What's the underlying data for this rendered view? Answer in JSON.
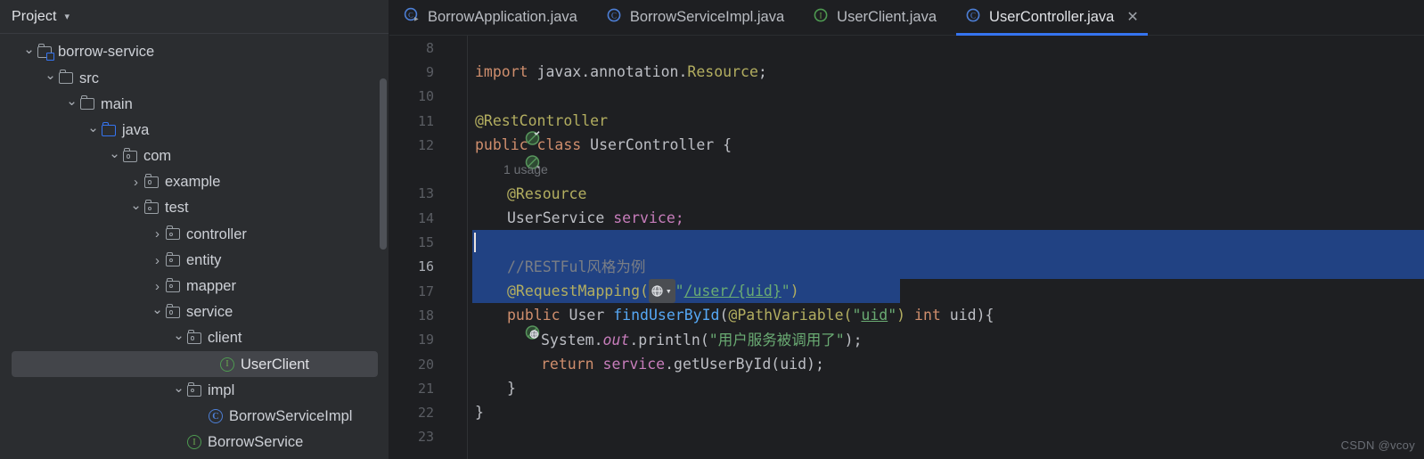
{
  "sidebar": {
    "header": {
      "title": "Project",
      "chevron_icon": "chevron-down-icon"
    },
    "tree": [
      {
        "label": "borrow-service",
        "icon": "module-folder-icon",
        "twisty": "expanded",
        "depth": 1
      },
      {
        "label": "src",
        "icon": "folder-icon",
        "twisty": "expanded",
        "depth": 2
      },
      {
        "label": "main",
        "icon": "folder-icon",
        "twisty": "expanded",
        "depth": 3
      },
      {
        "label": "java",
        "icon": "source-folder-icon",
        "twisty": "expanded",
        "depth": 4
      },
      {
        "label": "com",
        "icon": "package-icon",
        "twisty": "expanded",
        "depth": 5
      },
      {
        "label": "example",
        "icon": "package-icon",
        "twisty": "collapsed",
        "depth": 6
      },
      {
        "label": "test",
        "icon": "package-icon",
        "twisty": "expanded",
        "depth": 6
      },
      {
        "label": "controller",
        "icon": "package-icon",
        "twisty": "collapsed",
        "depth": 7
      },
      {
        "label": "entity",
        "icon": "package-icon",
        "twisty": "collapsed",
        "depth": 7
      },
      {
        "label": "mapper",
        "icon": "package-icon",
        "twisty": "collapsed",
        "depth": 7
      },
      {
        "label": "service",
        "icon": "package-icon",
        "twisty": "expanded",
        "depth": 7
      },
      {
        "label": "client",
        "icon": "package-icon",
        "twisty": "expanded",
        "depth": 8
      },
      {
        "label": "UserClient",
        "icon": "interface-icon",
        "twisty": "empty",
        "depth": 9,
        "selected": true
      },
      {
        "label": "impl",
        "icon": "package-icon",
        "twisty": "expanded",
        "depth": 8
      },
      {
        "label": "BorrowServiceImpl",
        "icon": "class-icon",
        "twisty": "empty",
        "depth": 9
      },
      {
        "label": "BorrowService",
        "icon": "interface-icon",
        "twisty": "empty",
        "depth": 8
      }
    ]
  },
  "editor": {
    "tabs": [
      {
        "label": "BorrowApplication.java",
        "icon": "spring-class-icon",
        "active": false,
        "closable": false
      },
      {
        "label": "BorrowServiceImpl.java",
        "icon": "class-icon",
        "active": false,
        "closable": false
      },
      {
        "label": "UserClient.java",
        "icon": "interface-icon",
        "active": false,
        "closable": false
      },
      {
        "label": "UserController.java",
        "icon": "class-icon",
        "active": true,
        "closable": true,
        "close_icon": "close-icon"
      }
    ],
    "gutter_lines": [
      "8",
      "9",
      "10",
      "11",
      "12",
      "13",
      "14",
      "15",
      "16",
      "17",
      "18",
      "19",
      "20",
      "21",
      "22",
      "23"
    ],
    "usage_hint": "1 usage",
    "code": {
      "l9_import": "import",
      "l9_pkg": " javax.annotation.",
      "l9_cls": "Resource",
      "l9_semi": ";",
      "l11": "@RestController",
      "l12_public": "public",
      "l12_class": "class",
      "l12_name": "UserController",
      "l12_brace": "{",
      "l13": "@Resource",
      "l14_type": "UserService",
      "l14_field": "service",
      "l14_semi": ";",
      "l16_comment": "//RESTFul风格为例",
      "l17_ann": "@RequestMapping",
      "l17_open": "(",
      "l17_quote1": "\"",
      "l17_url": "/user/{uid}",
      "l17_quote2": "\"",
      "l17_close": ")",
      "l18_public": "public",
      "l18_type": "User",
      "l18_method": "findUserById",
      "l18_paren": "(",
      "l18_ann": "@PathVariable",
      "l18_arg": "\"uid\"",
      "l18_int": "int",
      "l18_param": "uid",
      "l18_close": ")",
      "l18_brace": "{",
      "l19_sys": "System.",
      "l19_out": "out",
      "l19_println": ".println(",
      "l19_str": "\"用户服务被调用了\"",
      "l19_end": ");",
      "l20_return": "return",
      "l20_svc": "service",
      "l20_call": ".getUserById(uid);",
      "l21_brace": "}",
      "l22_brace": "}"
    }
  },
  "watermark": "CSDN @vcoy",
  "colors": {
    "accent": "#3574f0",
    "selection": "#214283",
    "sidebar_bg": "#2b2d30",
    "editor_bg": "#1e1f22",
    "keyword": "#cf8e6d",
    "annotation": "#b3ae60",
    "string": "#6aab73",
    "field": "#c77dbb",
    "method": "#56a8f5",
    "comment": "#7a7e85"
  }
}
